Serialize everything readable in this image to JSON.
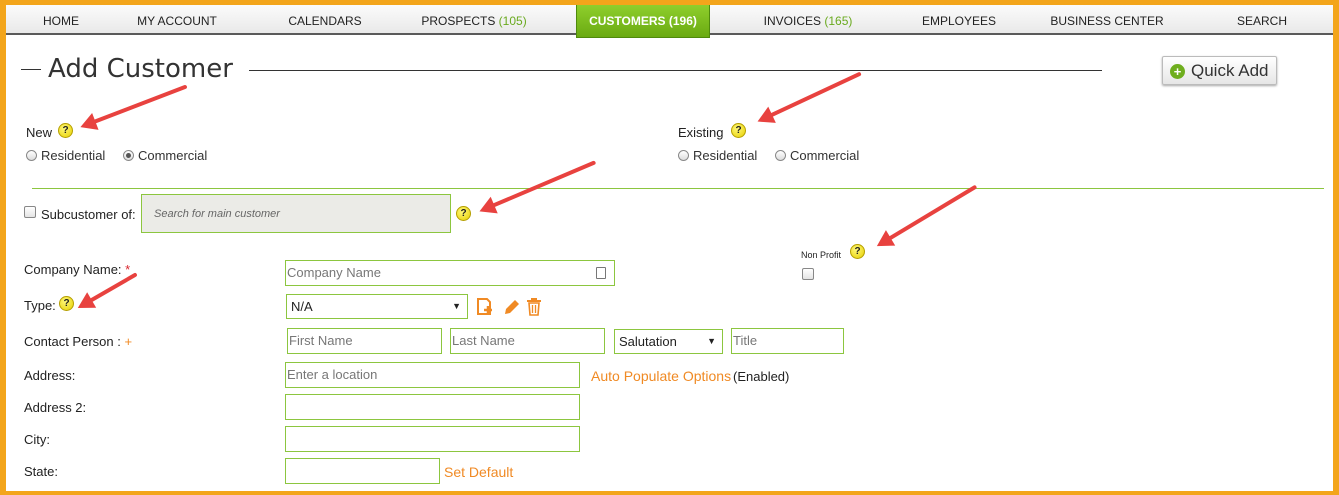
{
  "nav": {
    "home": "HOME",
    "my_account": "MY ACCOUNT",
    "calendars": "CALENDARS",
    "prospects": "PROSPECTS",
    "prospects_count": "(105)",
    "customers": "CUSTOMERS (196)",
    "invoices": "INVOICES",
    "invoices_count": "(165)",
    "employees": "EMPLOYEES",
    "business_center": "BUSINESS CENTER",
    "search": "SEARCH"
  },
  "page": {
    "title": "Add Customer",
    "quick_add": "Quick Add"
  },
  "new_section": {
    "label": "New",
    "residential": "Residential",
    "commercial": "Commercial",
    "selected": "Commercial"
  },
  "existing_section": {
    "label": "Existing",
    "residential": "Residential",
    "commercial": "Commercial"
  },
  "help_glyph": "?",
  "subcustomer": {
    "label": "Subcustomer of:",
    "placeholder": "Search for main customer"
  },
  "non_profit": {
    "label": "Non Profit"
  },
  "form": {
    "company_name_label": "Company Name:",
    "required_mark": "*",
    "company_name_placeholder": "Company Name",
    "type_label": "Type:",
    "type_value": "N/A",
    "contact_label": "Contact Person :",
    "contact_plus": "+",
    "first_name_placeholder": "First Name",
    "last_name_placeholder": "Last Name",
    "salutation_value": "Salutation",
    "title_placeholder": "Title",
    "address_label": "Address:",
    "address_placeholder": "Enter a location",
    "auto_populate": "Auto Populate Options",
    "auto_populate_state": "(Enabled)",
    "address2_label": "Address 2:",
    "city_label": "City:",
    "state_label": "State:",
    "set_default": "Set Default"
  },
  "colors": {
    "accent_green": "#6aaa12",
    "orange": "#f08a24",
    "frame": "#f3a51b",
    "arrow": "#e8423f"
  }
}
